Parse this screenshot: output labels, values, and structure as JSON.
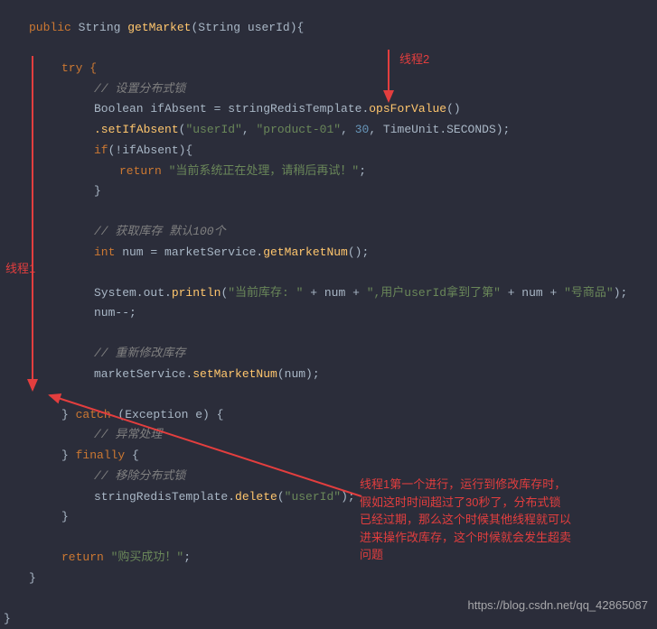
{
  "code": {
    "sig_public": "public",
    "sig_type": "String",
    "sig_name": "getMarket",
    "sig_param_type": "String",
    "sig_param_name": "userId",
    "sig_end": "){",
    "try_open": "try {",
    "c_setlock": "// 设置分布式锁",
    "l_bool_type": "Boolean",
    "l_bool_var": " ifAbsent = stringRedisTemplate.",
    "l_bool_m1": "opsForValue",
    "l_bool_p1": "()",
    "l_set_m": ".setIfAbsent",
    "l_set_a1": "\"userId\"",
    "l_set_a2": "\"product-01\"",
    "l_set_a3": "30",
    "l_set_a4": "TimeUnit.SECONDS",
    "l_if_open": "if(!ifAbsent){",
    "l_return": "return",
    "l_ret_str": "\"当前系统正在处理，请稍后再试！\"",
    "l_if_close": "}",
    "c_getstock": "// 获取库存   默认100个",
    "l_int": "int",
    "l_num_eq": " num = marketService.",
    "l_getnum": "getMarketNum",
    "l_getnum_p": "();",
    "l_sys1": "System.out.",
    "l_println": "println",
    "l_sys_s1": "\"当前库存: \"",
    "l_sys_mid": " + num + ",
    "l_sys_s2": "\",用户userId拿到了第\"",
    "l_sys_s3": "\"号商品\"",
    "l_numdec": "num--;",
    "c_modstock": "// 重新修改库存",
    "l_setnum_pre": "marketService.",
    "l_setnum": "setMarketNum",
    "l_setnum_p": "(num);",
    "catch_open": "} catch (Exception e) {",
    "c_catch": "// 异常处理",
    "finally_open": "} finally {",
    "c_remove": "// 移除分布式锁",
    "l_del_pre": "stringRedisTemplate.",
    "l_del_m": "delete",
    "l_del_a": "\"userId\"",
    "close1": "}",
    "l_retok": "return",
    "l_retok_s": "\"购买成功！\"",
    "close_method": "}",
    "close_class": "}"
  },
  "annotations": {
    "thread1": "线程1",
    "thread2": "线程2",
    "explain_l1": "线程1第一个进行，运行到修改库存时，",
    "explain_l2": "假如这时时间超过了30秒了，分布式锁",
    "explain_l3": "已经过期，那么这个时候其他线程就可以",
    "explain_l4": "进来操作改库存，这个时候就会发生超卖",
    "explain_l5": "问题"
  },
  "watermark": "https://blog.csdn.net/qq_42865087"
}
